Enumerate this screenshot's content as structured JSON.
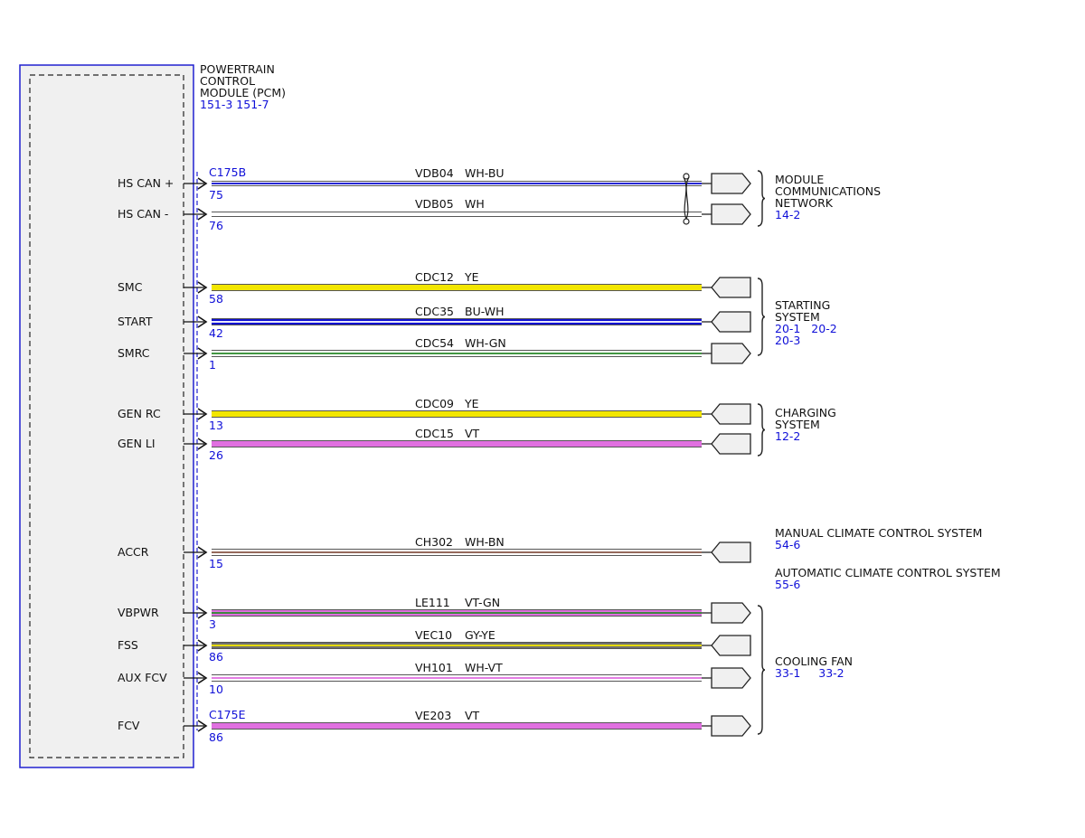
{
  "module": {
    "name_lines": [
      "POWERTRAIN",
      "CONTROL",
      "MODULE (PCM)"
    ],
    "refs": "151-3 151-7"
  },
  "connectors": {
    "top": "C175B",
    "bottom": "C175E"
  },
  "colors": {
    "module_border": "#2020d0",
    "module_fill": "#f0f0f0",
    "ref_text": "#1010d8",
    "YE": "#f2e600",
    "BU": "#1010d0",
    "WH": "#ffffff",
    "GN": "#2e8b2e",
    "VT": "#e070e0",
    "BN": "#8b5a4a",
    "GY": "#707070",
    "wire_outline": "#555555"
  },
  "circuits": [
    {
      "signal": "HS CAN +",
      "pin": "75",
      "circuit": "VDB04",
      "wire_color": "WH-BU",
      "twisted": true
    },
    {
      "signal": "HS CAN -",
      "pin": "76",
      "circuit": "VDB05",
      "wire_color": "WH",
      "twisted": true
    },
    {
      "signal": "SMC",
      "pin": "58",
      "circuit": "CDC12",
      "wire_color": "YE"
    },
    {
      "signal": "START",
      "pin": "42",
      "circuit": "CDC35",
      "wire_color": "BU-WH"
    },
    {
      "signal": "SMRC",
      "pin": "1",
      "circuit": "CDC54",
      "wire_color": "WH-GN"
    },
    {
      "signal": "GEN RC",
      "pin": "13",
      "circuit": "CDC09",
      "wire_color": "YE"
    },
    {
      "signal": "GEN LI",
      "pin": "26",
      "circuit": "CDC15",
      "wire_color": "VT"
    },
    {
      "signal": "ACCR",
      "pin": "15",
      "circuit": "CH302",
      "wire_color": "WH-BN"
    },
    {
      "signal": "VBPWR",
      "pin": "3",
      "circuit": "LE111",
      "wire_color": "VT-GN"
    },
    {
      "signal": "FSS",
      "pin": "86",
      "circuit": "VEC10",
      "wire_color": "GY-YE"
    },
    {
      "signal": "AUX FCV",
      "pin": "10",
      "circuit": "VH101",
      "wire_color": "WH-VT"
    },
    {
      "signal": "FCV",
      "pin": "86",
      "circuit": "VE203",
      "wire_color": "VT"
    }
  ],
  "destinations": [
    {
      "lines": [
        "MODULE",
        "COMMUNICATIONS",
        "NETWORK"
      ],
      "refs": [
        "14-2"
      ]
    },
    {
      "lines": [
        "STARTING",
        "SYSTEM"
      ],
      "refs": [
        "20-1   20-2",
        "20-3"
      ]
    },
    {
      "lines": [
        "CHARGING",
        "SYSTEM"
      ],
      "refs": [
        "12-2"
      ]
    },
    {
      "lines": [
        "MANUAL CLIMATE CONTROL SYSTEM"
      ],
      "refs": [
        "54-6"
      ]
    },
    {
      "lines": [
        "AUTOMATIC CLIMATE CONTROL SYSTEM"
      ],
      "refs": [
        "55-6"
      ]
    },
    {
      "lines": [
        "COOLING FAN"
      ],
      "refs": [
        "33-1     33-2"
      ]
    }
  ]
}
